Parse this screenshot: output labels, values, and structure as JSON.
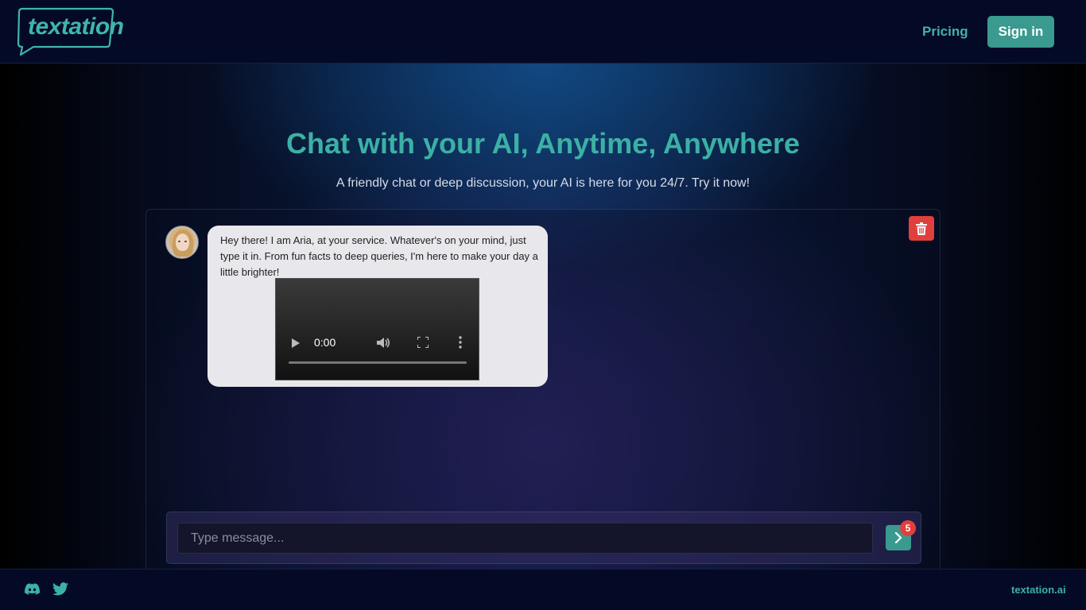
{
  "header": {
    "logo_text": "textation",
    "pricing_label": "Pricing",
    "signin_label": "Sign in"
  },
  "hero": {
    "title": "Chat with your AI, Anytime, Anywhere",
    "subtitle": "A friendly chat or deep discussion, your AI is here for you 24/7. Try it now!"
  },
  "chat": {
    "delete_icon": "trash-icon",
    "messages": [
      {
        "sender_avatar": "avatar",
        "text": "Hey there! I am Aria, at your service. Whatever's on your mind, just type it in. From fun facts to deep queries, I'm here to make your day a little brighter!",
        "video": {
          "time": "0:00"
        }
      }
    ],
    "input": {
      "placeholder": "Type message...",
      "value": ""
    },
    "send_icon": "chevron-right-icon",
    "send_badge": "5"
  },
  "footer": {
    "icons": [
      "discord-icon",
      "twitter-icon"
    ],
    "domain": "textation.ai"
  },
  "colors": {
    "accent": "#3cb0a5",
    "button": "#3a9a90",
    "danger": "#e0403c",
    "header_bg": "#040a26"
  }
}
